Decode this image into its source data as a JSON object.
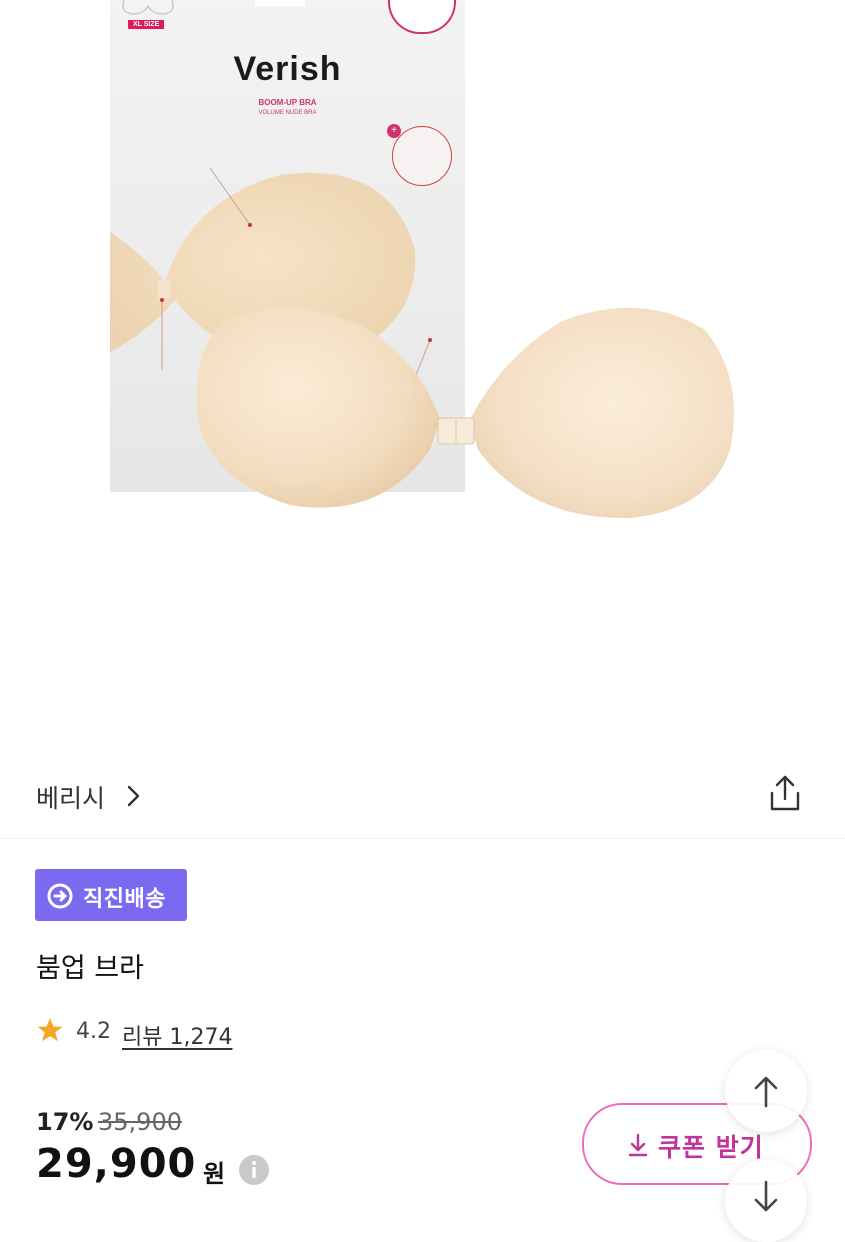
{
  "hero": {
    "package": {
      "badge": "XL SIZE",
      "logo": "Verish",
      "product_line": "BOOM-UP BRA",
      "product_subline": "VOLUME NUDE BRA"
    }
  },
  "brand": {
    "name": "베리시",
    "chevron_icon": "chevron-right-icon",
    "share_icon": "share-icon"
  },
  "badge": {
    "icon": "direct-delivery-icon",
    "label": "직진배송",
    "color": "#7b69f0"
  },
  "product": {
    "title": "붐업 브라"
  },
  "rating": {
    "star_icon": "star-icon",
    "value": "4.2",
    "review_label": "리뷰 1,274"
  },
  "pricing": {
    "discount": "17%",
    "original_price": "35,900",
    "price": "29,900",
    "unit": "원",
    "info_icon": "info-icon"
  },
  "coupon": {
    "icon": "download-icon",
    "label": "쿠폰 받기",
    "color": "#c0359a"
  },
  "floating": {
    "scroll_top_icon": "arrow-up-icon",
    "scroll_down_icon": "arrow-down-icon"
  }
}
